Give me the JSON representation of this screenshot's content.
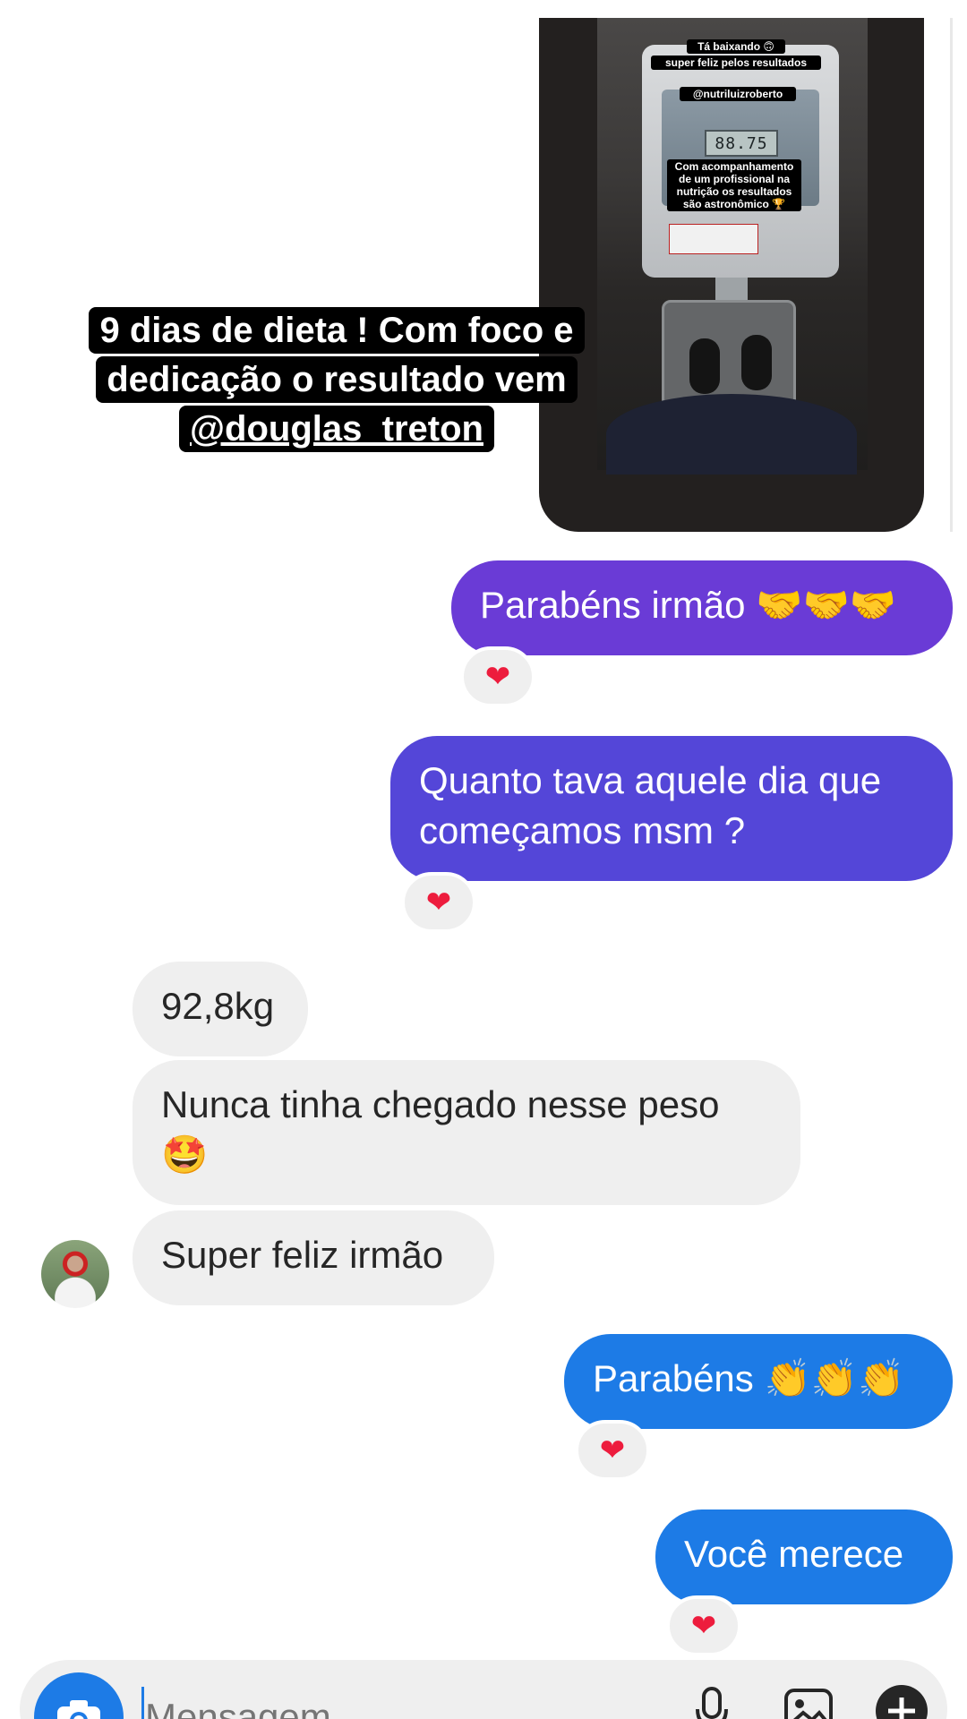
{
  "story": {
    "author_handle": "douglas_treton",
    "sticker_1": "Tá baixando 🙃",
    "sticker_2": "super feliz pelos resultados",
    "sticker_mention": "@nutriluizroberto",
    "scale_reading": "88.75",
    "sticker_3": "Com acompanhamento de um profissional na nutrição os resultados são astronômico 🏆",
    "caption_line1": "9 dias de dieta ! Com foco e",
    "caption_line2": "dedicação o resultado vem",
    "caption_mention": "@douglas_treton"
  },
  "colors": {
    "purple": "#6a3bd6",
    "indigo": "#5446d8",
    "blue": "#1d7be6",
    "incoming": "#efefef",
    "heart": "#ed1c3d"
  },
  "messages": [
    {
      "direction": "outgoing",
      "text": "Parabéns irmão 🤝🤝🤝",
      "reaction": "❤"
    },
    {
      "direction": "outgoing",
      "text": "Quanto tava aquele dia que\ncomeçamos msm ?",
      "reaction": "❤"
    },
    {
      "direction": "incoming",
      "text": "92,8kg"
    },
    {
      "direction": "incoming",
      "text": "Nunca tinha chegado nesse peso\n🤩"
    },
    {
      "direction": "incoming",
      "text": "Super feliz irmão"
    },
    {
      "direction": "outgoing",
      "text": "Parabéns 👏👏👏",
      "reaction": "❤"
    },
    {
      "direction": "outgoing",
      "text": "Você merece",
      "reaction": "❤"
    }
  ],
  "composer": {
    "placeholder": "Mensagem...",
    "camera_icon": "camera-icon",
    "mic_icon": "microphone-icon",
    "gallery_icon": "gallery-icon",
    "add_icon": "plus-icon"
  }
}
